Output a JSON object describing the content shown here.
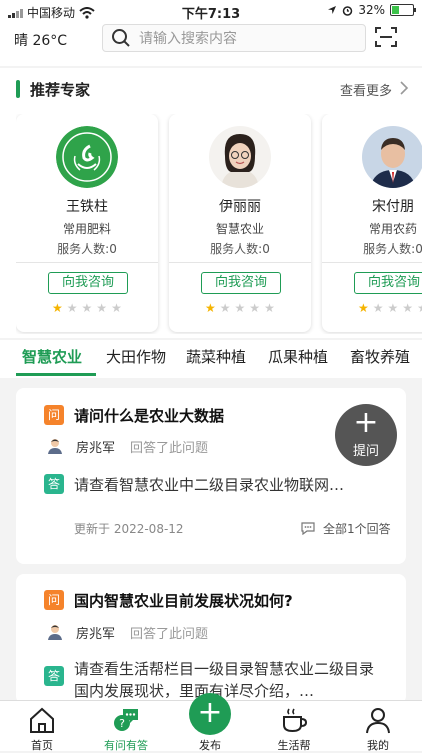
{
  "status_bar": {
    "carrier": "中国移动",
    "time": "下午7:13",
    "battery": "32%"
  },
  "topbar": {
    "weather": "晴 26°C",
    "search_placeholder": "请输入搜索内容"
  },
  "experts": {
    "title": "推荐专家",
    "more": "查看更多",
    "items": [
      {
        "name": "王铁柱",
        "specialty": "常用肥料",
        "served": "服务人数:0",
        "consult": "向我咨询",
        "rating": 1
      },
      {
        "name": "伊丽丽",
        "specialty": "智慧农业",
        "served": "服务人数:0",
        "consult": "向我咨询",
        "rating": 1
      },
      {
        "name": "宋付朋",
        "specialty": "常用农药",
        "served": "服务人数:0",
        "consult": "向我咨询",
        "rating": 1
      }
    ]
  },
  "tabs": [
    "智慧农业",
    "大田作物",
    "蔬菜种植",
    "瓜果种植",
    "畜牧养殖"
  ],
  "questions": [
    {
      "badge_q": "问",
      "title": "请问什么是农业大数据",
      "user": "房兆军",
      "action": "回答了此问题",
      "badge_a": "答",
      "answer": "请查看智慧农业中二级目录农业物联网…",
      "updated": "更新于 2022-08-12",
      "count": "全部1个回答"
    },
    {
      "badge_q": "问",
      "title": "国内智慧农业目前发展状况如何?",
      "user": "房兆军",
      "action": "回答了此问题",
      "badge_a": "答",
      "answer": "请查看生活帮栏目一级目录智慧农业二级目录国内发展现状，里面有详尽介绍，…"
    }
  ],
  "fab": {
    "label": "提问"
  },
  "bottom_nav": [
    {
      "label": "首页"
    },
    {
      "label": "有问有答"
    },
    {
      "label": "发布"
    },
    {
      "label": "生活帮"
    },
    {
      "label": "我的"
    }
  ],
  "colors": {
    "accent": "#1f9c55",
    "question_badge": "#f5832b",
    "answer_badge": "#2ab58e",
    "star": "#f5b400"
  }
}
